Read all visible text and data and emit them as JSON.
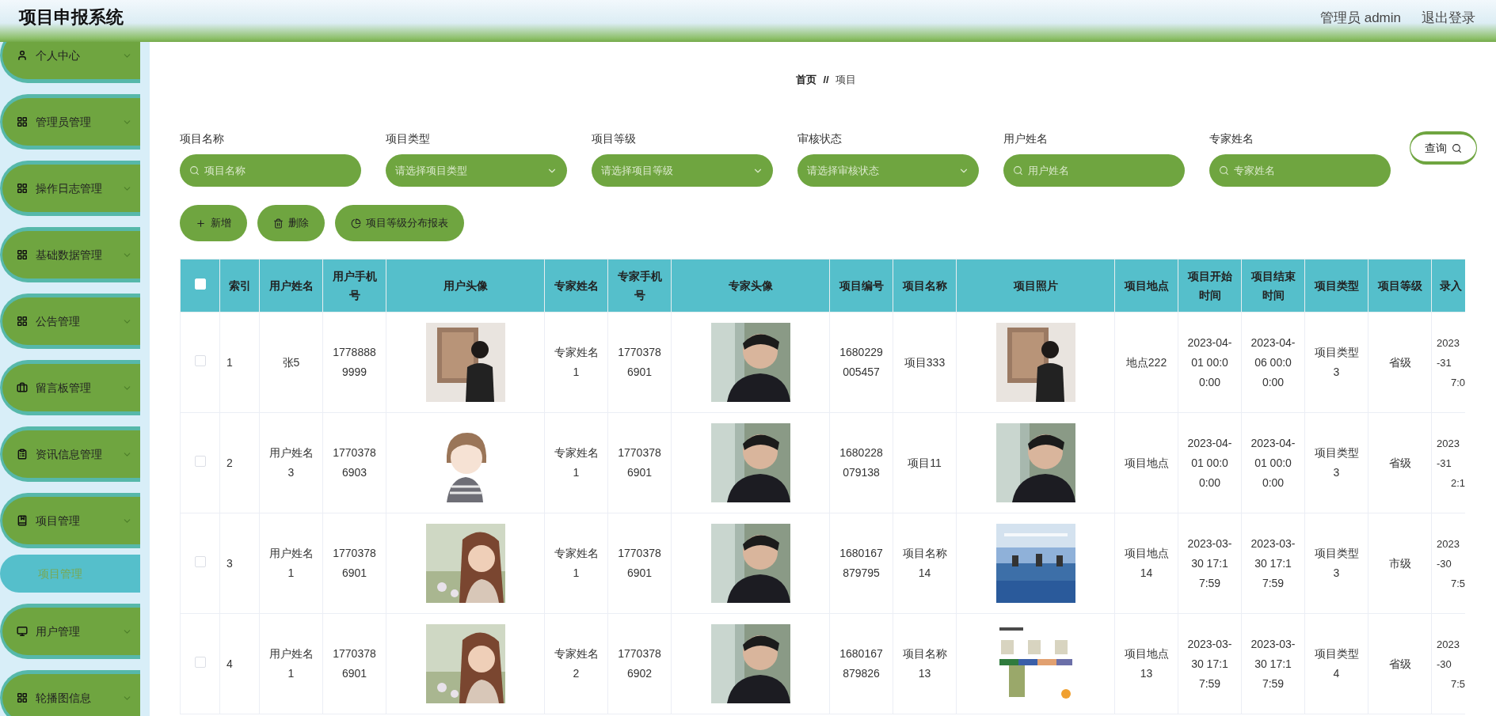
{
  "header": {
    "title": "项目申报系统",
    "user": "管理员 admin",
    "logout": "退出登录"
  },
  "sidebar": {
    "items": [
      {
        "label": "个人中心"
      },
      {
        "label": "管理员管理"
      },
      {
        "label": "操作日志管理"
      },
      {
        "label": "基础数据管理"
      },
      {
        "label": "公告管理"
      },
      {
        "label": "留言板管理"
      },
      {
        "label": "资讯信息管理"
      },
      {
        "label": "项目管理",
        "children": [
          {
            "label": "项目管理",
            "selected": true
          }
        ]
      },
      {
        "label": "用户管理"
      },
      {
        "label": "轮播图信息"
      }
    ]
  },
  "breadcrumb": [
    "首页",
    "//",
    "项目"
  ],
  "filters": [
    {
      "kind": "text",
      "label": "项目名称",
      "placeholder": "项目名称"
    },
    {
      "kind": "select",
      "label": "项目类型",
      "placeholder": "请选择项目类型"
    },
    {
      "kind": "select",
      "label": "项目等级",
      "placeholder": "请选择项目等级"
    },
    {
      "kind": "select",
      "label": "审核状态",
      "placeholder": "请选择审核状态"
    },
    {
      "kind": "text",
      "label": "用户姓名",
      "placeholder": "用户姓名"
    },
    {
      "kind": "text",
      "label": "专家姓名",
      "placeholder": "专家姓名"
    }
  ],
  "search_button": "查询",
  "actions": [
    {
      "label": "新增"
    },
    {
      "label": "删除"
    },
    {
      "label": "项目等级分布报表"
    }
  ],
  "table": {
    "select_all": {
      "checked": false
    },
    "columns": [
      {
        "kind": "text",
        "label": "索引"
      },
      {
        "kind": "text",
        "label": "用户姓名"
      },
      {
        "kind": "text",
        "label": "用户手机号"
      },
      {
        "label": "用户头像"
      },
      {
        "kind": "text",
        "label": "专家姓名"
      },
      {
        "kind": "text",
        "label": "专家手机号"
      },
      {
        "label": "专家头像"
      },
      {
        "kind": "text",
        "label": "项目编号"
      },
      {
        "kind": "text",
        "label": "项目名称"
      },
      {
        "label": "项目照片"
      },
      {
        "kind": "text",
        "label": "项目地点"
      },
      {
        "kind": "text",
        "label": "项目开始时间"
      },
      {
        "kind": "text",
        "label": "项目结束时间"
      },
      {
        "kind": "text",
        "label": "项目类型"
      },
      {
        "kind": "text",
        "label": "项目等级"
      },
      {
        "kind": "cut",
        "label": "录入"
      }
    ],
    "rows": [
      {
        "checked": false,
        "cells": [
          "1",
          "张5",
          "17788889999",
          null,
          "专家姓名1",
          "17703786901",
          null,
          "1680229005457",
          "项目333",
          null,
          "地点222",
          "2023-04-01 00:00:00",
          "2023-04-06 00:00:00",
          "项目类型3",
          "省级",
          [
            "2023",
            "-31",
            "7:0"
          ]
        ]
      },
      {
        "checked": false,
        "cells": [
          "2",
          "用户姓名3",
          "17703786903",
          null,
          "专家姓名1",
          "17703786901",
          null,
          "1680228079138",
          "项目11",
          null,
          "项目地点",
          "2023-04-01 00:00:00",
          "2023-04-01 00:00:00",
          "项目类型3",
          "省级",
          [
            "2023",
            "-31",
            "2:1"
          ]
        ]
      },
      {
        "checked": false,
        "cells": [
          "3",
          "用户姓名1",
          "17703786901",
          null,
          "专家姓名1",
          "17703786901",
          null,
          "1680167879795",
          "项目名称14",
          null,
          "项目地点14",
          "2023-03-30 17:17:59",
          "2023-03-30 17:17:59",
          "项目类型3",
          "市级",
          [
            "2023",
            "-30",
            "7:5"
          ]
        ]
      },
      {
        "checked": false,
        "cells": [
          "4",
          "用户姓名1",
          "17703786901",
          null,
          "专家姓名2",
          "17703786902",
          null,
          "1680167879826",
          "项目名称13",
          null,
          "项目地点13",
          "2023-03-30 17:17:59",
          "2023-03-30 17:17:59",
          "项目类型4",
          "省级",
          [
            "2023",
            "-30",
            "7:5"
          ]
        ]
      }
    ]
  }
}
